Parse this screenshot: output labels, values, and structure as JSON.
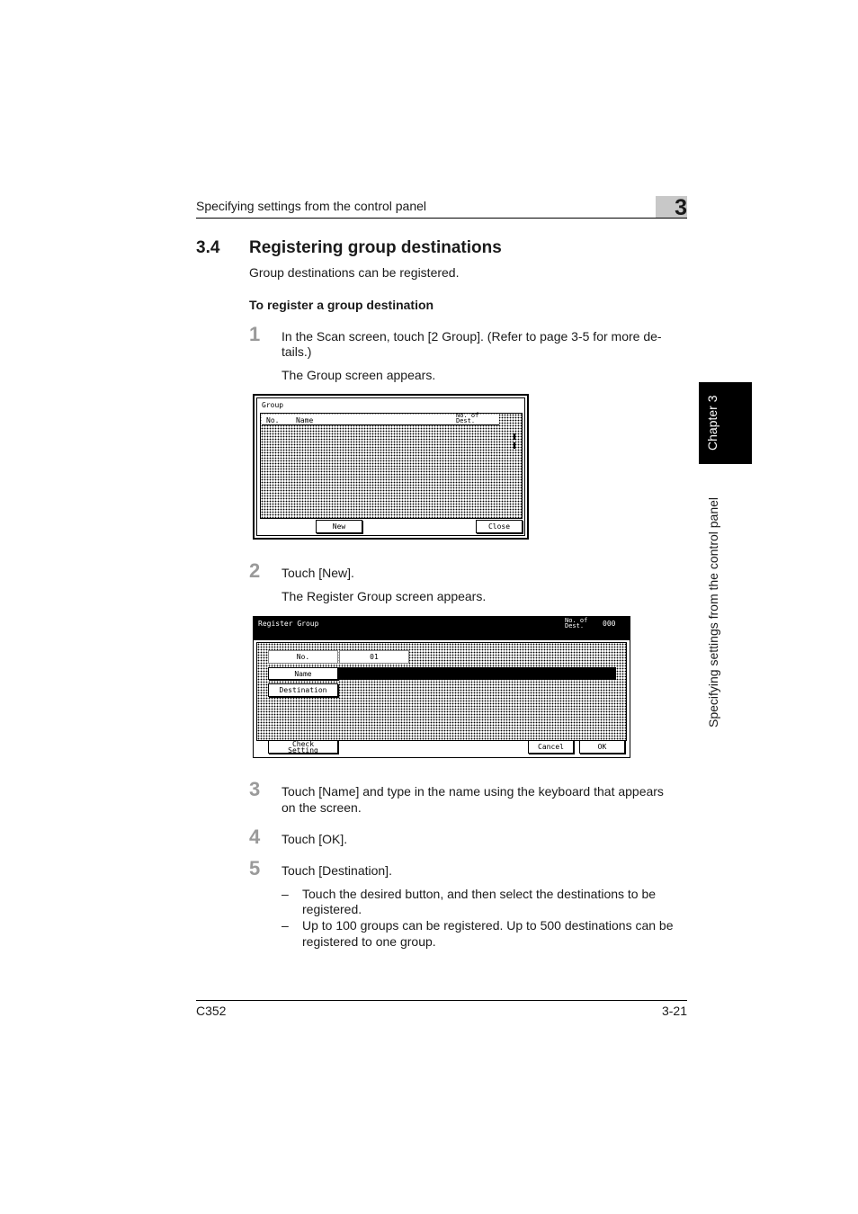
{
  "header": {
    "running_title": "Specifying settings from the control panel",
    "chapter_number": "3"
  },
  "section": {
    "number": "3.4",
    "title": "Registering group destinations",
    "intro": "Group destinations can be registered."
  },
  "procedure": {
    "heading": "To register a group destination",
    "steps": [
      {
        "num": "1",
        "text": "In the Scan screen, touch [2 Group]. (Refer to page 3-5 for more de-tails.)",
        "text_line1": "In the Scan screen, touch [2 Group]. (Refer to page 3-5 for more de-",
        "text_line2": "tails.)",
        "result": "The Group screen appears."
      },
      {
        "num": "2",
        "text": "Touch [New].",
        "result": "The Register Group screen appears."
      },
      {
        "num": "3",
        "text_line1": "Touch [Name] and type in the name using the keyboard that appears",
        "text_line2": "on the screen."
      },
      {
        "num": "4",
        "text": "Touch [OK]."
      },
      {
        "num": "5",
        "text": "Touch [Destination].",
        "bullets": [
          {
            "line1": "Touch the desired button, and then select the destinations to be",
            "line2": "registered."
          },
          {
            "line1": "Up to 100 groups can be registered. Up to 500 destinations can be",
            "line2": "registered to one group."
          }
        ]
      }
    ]
  },
  "group_screen": {
    "title": "Group",
    "col_no": "No.",
    "col_name": "Name",
    "col_dest_1": "No. of",
    "col_dest_2": "Dest.",
    "new_button": "New",
    "close_button": "Close"
  },
  "register_screen": {
    "title": "Register Group",
    "count_label_1": "No. of",
    "count_label_2": "Dest.",
    "count_value": "000",
    "no_label": "No.",
    "no_value": "01",
    "name_button": "Name",
    "destination_button": "Destination",
    "check_setting_1": "Check",
    "check_setting_2": "Setting",
    "cancel_button": "Cancel",
    "ok_button": "OK"
  },
  "side_tab": {
    "chapter_label": "Chapter 3",
    "section_label": "Specifying settings from the control panel"
  },
  "footer": {
    "model": "C352",
    "page": "3-21"
  }
}
